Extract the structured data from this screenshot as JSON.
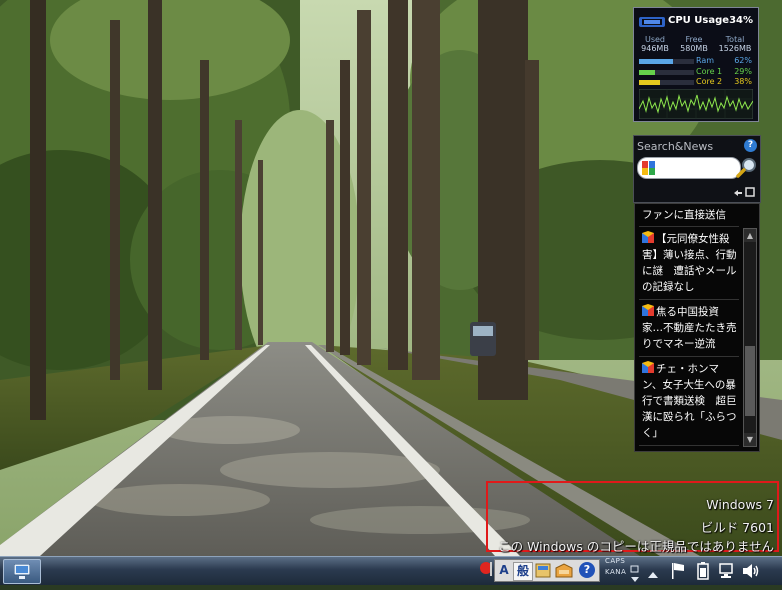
{
  "watermark": {
    "line1": "Windows 7",
    "line2": "ビルド 7601",
    "line3": "この Windows のコピーは正規品ではありません"
  },
  "cpu_gadget": {
    "title": "CPU Usage",
    "cpu_percent": "34%",
    "memory_headers": [
      "Used",
      "Free",
      "Total"
    ],
    "memory_values": [
      "946MB",
      "580MB",
      "1526MB"
    ],
    "bars": [
      {
        "name": "Ram",
        "value": "62%",
        "fraction": 0.62,
        "color": "#5aa6e6"
      },
      {
        "name": "Core 1",
        "value": "29%",
        "fraction": 0.29,
        "color": "#66d14b"
      },
      {
        "name": "Core 2",
        "value": "38%",
        "fraction": 0.38,
        "color": "#e4c81e"
      }
    ],
    "graph_color": "#8ee84e"
  },
  "search_gadget": {
    "title": "Search&News",
    "help": "?",
    "search_placeholder": ""
  },
  "news": {
    "top_item": "ファンに直接送信",
    "items": [
      {
        "text": "【元同僚女性殺害】薄い接点、行動に謎　遭話やメールの記録なし"
      },
      {
        "text": "焦る中国投資家…不動産たたき売りでマネー逆流"
      },
      {
        "text": "チェ・ホンマン、女子大生への暴行で書類送検　超巨漢に殴られ「ふらつく」"
      }
    ]
  },
  "taskbar": {
    "ime_mode": "A",
    "ime_kana": "般",
    "ime_help": "?",
    "caps_label": "CAPS",
    "kana_label": "KANA"
  },
  "colors": {
    "watermark_border": "#e0191a",
    "taskbar": "#2b3a4f"
  }
}
